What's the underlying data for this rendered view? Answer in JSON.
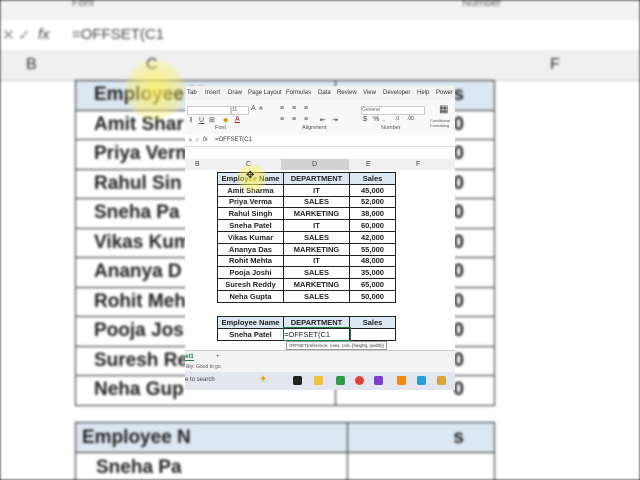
{
  "background": {
    "top_labels": [
      "Font",
      "Number"
    ],
    "formula_text": "=OFFSET(C1",
    "fx_label": "fx",
    "columns": [
      "B",
      "C",
      "F"
    ],
    "table_rows": [
      [
        "Employee N",
        "s"
      ],
      [
        "Amit Shar",
        "0"
      ],
      [
        "Priya Verm",
        "0"
      ],
      [
        "Rahul Sin",
        "0"
      ],
      [
        "Sneha Pa",
        "0"
      ],
      [
        "Vikas Kum",
        "0"
      ],
      [
        "Ananya D",
        "0"
      ],
      [
        "Rohit Meh",
        "0"
      ],
      [
        "Pooja Jos",
        "0"
      ],
      [
        "Suresh Re",
        "0"
      ],
      [
        "Neha Gup",
        "0"
      ]
    ],
    "right_numbers": [
      "000",
      "000",
      "000",
      "000",
      "000",
      "000",
      "000",
      "000",
      "000",
      "000",
      "000"
    ],
    "bottom_rows": [
      [
        "Employee N",
        "s"
      ],
      [
        "Sneha Pa",
        ""
      ]
    ]
  },
  "ribbon": {
    "tabs": [
      "Tab",
      "Insert",
      "Draw",
      "Page Layout",
      "Formulas",
      "Data",
      "Review",
      "View",
      "Developer",
      "Help",
      "Power"
    ],
    "groups": [
      "Font",
      "Alignment",
      "Number"
    ],
    "font_size": "11",
    "number_format": "General",
    "conditional_label": "Conditional Formatting"
  },
  "formula_bar": {
    "fx_label": "fx",
    "formula": "=OFFSET(C1"
  },
  "columns": [
    "B",
    "C",
    "D",
    "E",
    "F"
  ],
  "main_table": {
    "headers": [
      "Employee Name",
      "DEPARTMENT",
      "Sales"
    ],
    "rows": [
      [
        "Amit Sharma",
        "IT",
        "45,000"
      ],
      [
        "Priya Verma",
        "SALES",
        "52,000"
      ],
      [
        "Rahul Singh",
        "MARKETING",
        "38,000"
      ],
      [
        "Sneha Patel",
        "IT",
        "60,000"
      ],
      [
        "Vikas Kumar",
        "SALES",
        "42,000"
      ],
      [
        "Ananya Das",
        "MARKETING",
        "55,000"
      ],
      [
        "Rohit Mehta",
        "IT",
        "48,000"
      ],
      [
        "Pooja Joshi",
        "SALES",
        "35,000"
      ],
      [
        "Suresh Reddy",
        "MARKETING",
        "65,000"
      ],
      [
        "Neha Gupta",
        "SALES",
        "50,000"
      ]
    ]
  },
  "lookup_table": {
    "headers": [
      "Employee Name",
      "DEPARTMENT",
      "Sales"
    ],
    "row": [
      "Sneha Patel",
      "=OFFSET(C1",
      ""
    ]
  },
  "tooltip": "OFFSET(reference, rows, cols, [height], [width])",
  "sheet_tab": "et1",
  "add_sheet": "+",
  "status": "ility: Good to go",
  "taskbar": {
    "search": "e to search"
  },
  "colors": {
    "header_fill": "#dbe7f3",
    "selected_cell_border": "#1a7f3f",
    "highlight": "#fff05a"
  }
}
